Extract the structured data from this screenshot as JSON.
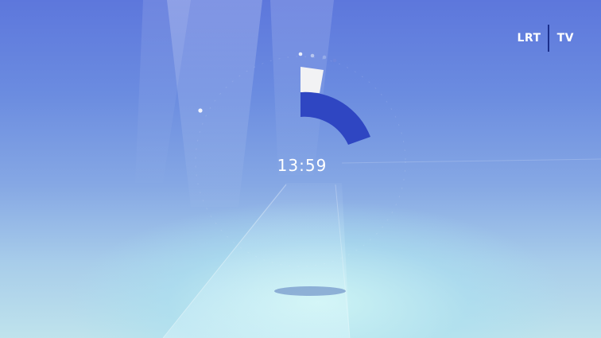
{
  "logo": {
    "channel": "LRT",
    "tv": "TV"
  },
  "clock": {
    "time": "13:59"
  },
  "colors": {
    "background_top": "#5d77dc",
    "background_bottom": "#bfe3ec",
    "arc_blue": "#2f46c2",
    "arc_white": "#f2f2f4",
    "logo_separator": "#1b2f8c",
    "text": "#ffffff"
  }
}
